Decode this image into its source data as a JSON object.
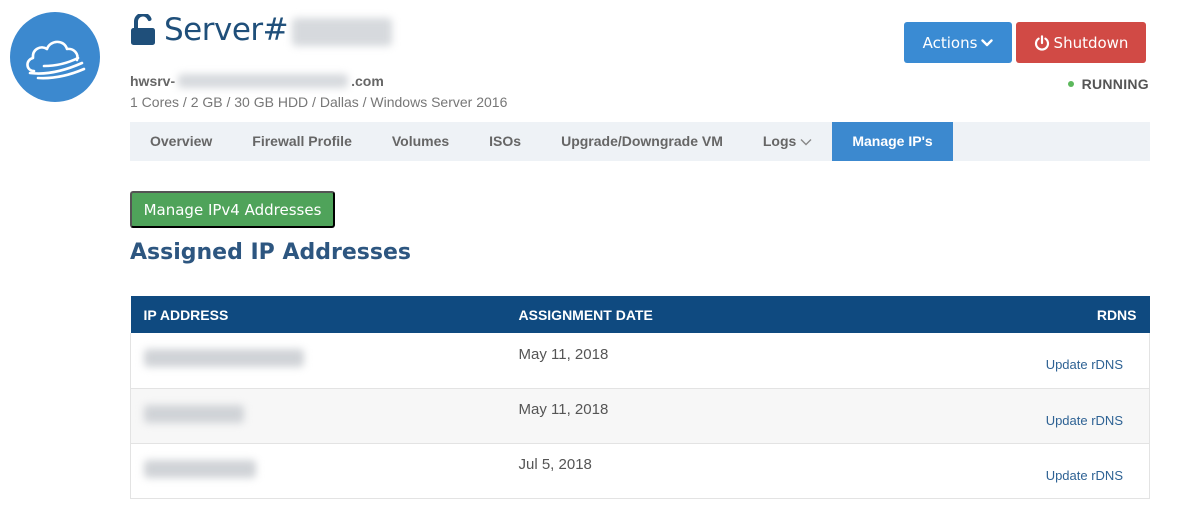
{
  "header": {
    "server_prefix": "Server#",
    "hostname_prefix": "hwsrv-",
    "hostname_suffix": ".com",
    "specs": "1 Cores / 2 GB / 30 GB HDD / Dallas / Windows Server 2016",
    "status": "RUNNING"
  },
  "buttons": {
    "actions": "Actions",
    "shutdown": "Shutdown"
  },
  "tabs": [
    {
      "label": "Overview"
    },
    {
      "label": "Firewall Profile"
    },
    {
      "label": "Volumes"
    },
    {
      "label": "ISOs"
    },
    {
      "label": "Upgrade/Downgrade VM"
    },
    {
      "label": "Logs"
    },
    {
      "label": "Manage IP's"
    }
  ],
  "active_tab": "Manage IP's",
  "manage_button": "Manage IPv4 Addresses",
  "section_title": "Assigned IP Addresses",
  "table": {
    "headers": [
      "IP ADDRESS",
      "ASSIGNMENT DATE",
      "RDNS"
    ],
    "rows": [
      {
        "date": "May 11, 2018",
        "action": "Update rDNS"
      },
      {
        "date": "May 11, 2018",
        "action": "Update rDNS"
      },
      {
        "date": "Jul 5, 2018",
        "action": "Update rDNS"
      }
    ]
  },
  "colors": {
    "primary": "#3c89cf",
    "danger": "#d14a45",
    "success": "#4fa35a",
    "table_header": "#0f4a80",
    "status_dot": "#5cb85c"
  },
  "icons": {
    "logo": "cloud-icon",
    "title": "unlock-icon",
    "actions": "chevron-down-icon",
    "shutdown": "power-icon",
    "logs": "chevron-down-icon"
  }
}
